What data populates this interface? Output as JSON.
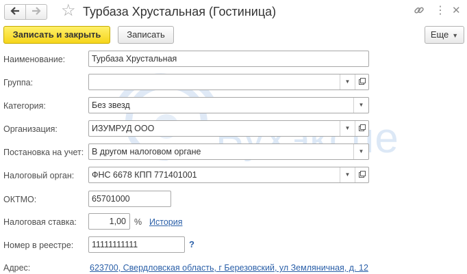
{
  "header": {
    "title": "Турбаза Хрустальная (Гостиница)"
  },
  "toolbar": {
    "save_close_label": "Записать и закрыть",
    "save_label": "Записать",
    "more_label": "Еще"
  },
  "form": {
    "name_label": "Наименование:",
    "name_value": "Турбаза Хрустальная",
    "group_label": "Группа:",
    "group_value": "",
    "category_label": "Категория:",
    "category_value": "Без звезд",
    "organization_label": "Организация:",
    "organization_value": "ИЗУМРУД ООО",
    "registration_label": "Постановка на учет:",
    "registration_value": "В другом налоговом органе",
    "tax_office_label": "Налоговый орган:",
    "tax_office_value": "ФНС 6678 КПП 771401001",
    "oktmo_label": "ОКТМО:",
    "oktmo_value": "65701000",
    "tax_rate_label": "Налоговая ставка:",
    "tax_rate_value": "1,00",
    "tax_rate_unit": "%",
    "history_link": "История",
    "registry_label": "Номер в реестре:",
    "registry_value": "11111111111",
    "help_mark": "?",
    "address_label": "Адрес:",
    "address_value": "623700, Свердловская область, г Березовский, ул Земляничная, д. 12"
  },
  "watermark": {
    "text": "Бухэкспе"
  },
  "icons": {
    "back": "arrow-left-icon",
    "forward": "arrow-right-icon",
    "favorite": "star-icon",
    "link": "link-icon",
    "menu": "kebab-menu-icon",
    "close": "close-icon",
    "dropdown": "triangle-down-icon",
    "open": "open-form-icon"
  },
  "colors": {
    "primary_button": "#f6d51b",
    "link": "#2a5fa8",
    "watermark": "#dce8f6"
  }
}
